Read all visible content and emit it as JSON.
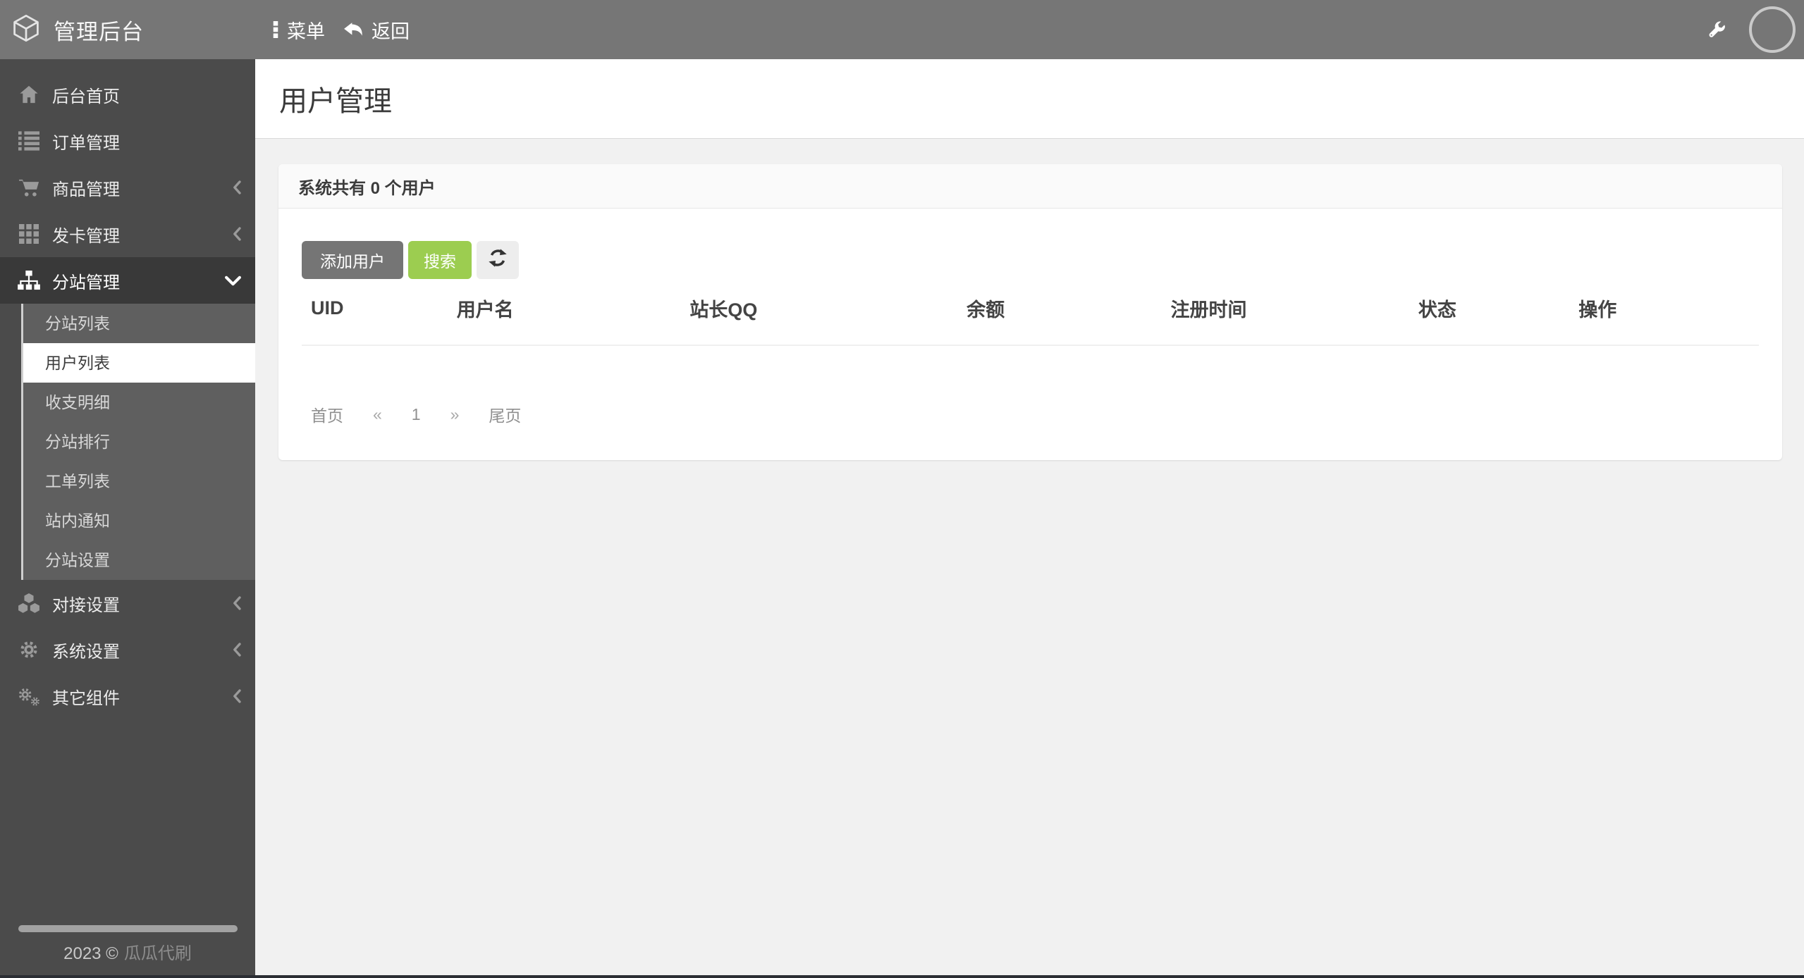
{
  "app": {
    "brand": "管理后台"
  },
  "topbar": {
    "menu_label": "菜单",
    "back_label": "返回",
    "icons": {
      "brand": "cube-icon",
      "menu": "ellipsis-v-icon",
      "back": "undo-arrow-icon",
      "tools": "wrench-icon",
      "user": "avatar-circle"
    }
  },
  "sidebar": {
    "items": [
      {
        "label": "后台首页",
        "icon": "home-icon"
      },
      {
        "label": "订单管理",
        "icon": "list-icon"
      },
      {
        "label": "商品管理",
        "icon": "cart-icon",
        "chevron": "left"
      },
      {
        "label": "发卡管理",
        "icon": "grid-icon",
        "chevron": "left"
      },
      {
        "label": "分站管理",
        "icon": "sitemap-icon",
        "chevron": "down",
        "active": true,
        "children": [
          {
            "label": "分站列表"
          },
          {
            "label": "用户列表",
            "active": true
          },
          {
            "label": "收支明细"
          },
          {
            "label": "分站排行"
          },
          {
            "label": "工单列表"
          },
          {
            "label": "站内通知"
          },
          {
            "label": "分站设置"
          }
        ]
      },
      {
        "label": "对接设置",
        "icon": "cubes-icon",
        "chevron": "left"
      },
      {
        "label": "系统设置",
        "icon": "gear-icon",
        "chevron": "left"
      },
      {
        "label": "其它组件",
        "icon": "gears-icon",
        "chevron": "left"
      }
    ],
    "footer": {
      "year": "2023 ©",
      "site": "瓜瓜代刷"
    }
  },
  "page": {
    "title": "用户管理",
    "panel": {
      "header": "系统共有 0 个用户",
      "user_count": "0",
      "buttons": {
        "add": "添加用户",
        "search": "搜索",
        "refresh": "refresh-icon"
      },
      "table": {
        "headers": [
          "UID",
          "用户名",
          "站长QQ",
          "余额",
          "注册时间",
          "状态",
          "操作"
        ],
        "rows": []
      },
      "pagination": {
        "items": [
          "首页",
          "«",
          "1",
          "»",
          "尾页"
        ],
        "current_page": "1"
      }
    }
  },
  "colors": {
    "topbar": "#767676",
    "sidebar": "#4b4b4b",
    "sidebar_active_item": "#393939",
    "submenu_bg": "#5f5f5f",
    "submenu_line": "#cfcfcf",
    "content_bg": "#f1f1f1",
    "panel_header_bg": "#fafafa",
    "accent_green": "#9ccd50",
    "button_gray": "#757575",
    "bottom_strip": "#2b2e34"
  }
}
